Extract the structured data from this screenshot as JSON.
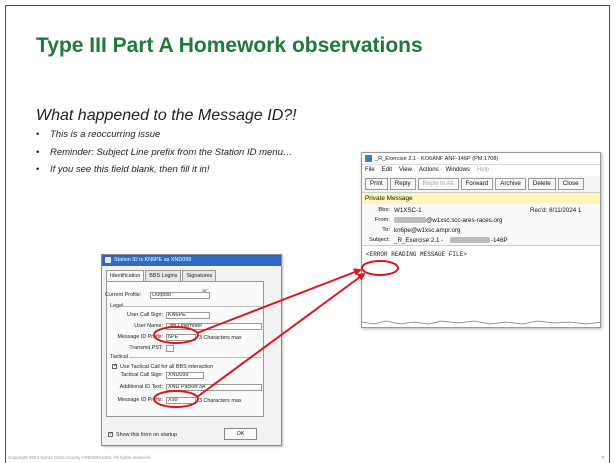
{
  "slide": {
    "title": "Type III Part A Homework observations",
    "subhead": "What happened to the Message ID?!",
    "bullets": [
      "This is a reoccurring issue",
      "Reminder:  Subject Line prefix from the Station ID menu…",
      "If you see this field blank, then fill it in!"
    ],
    "footer": "Copyright 2024 Santa Clara County ARES/RACES.  All rights reserved.",
    "page_number": "8"
  },
  "station_dialog": {
    "title": "Station ID is KN6PE as XND099",
    "tabs": [
      "Identification",
      "BBS Logins",
      "Signatures"
    ],
    "current_profile_label": "Current Profile:",
    "current_profile_value": "Outpost",
    "legal_label": "Legal",
    "user_call_sign_label": "User Call Sign:",
    "user_call_sign_value": "KN6PE",
    "user_name_label": "User Name:",
    "user_name_value": "Jim Oberhofer",
    "message_id_prefix_label": "Message ID Prefix:",
    "message_id_prefix_value": "6PE",
    "characters_max_1": "3 Characters max",
    "transmit_pst_label": "Transmit PST:",
    "tactical_label": "Tactical",
    "use_tactical_label": "Use Tactical Call for all BBS interaction",
    "tactical_call_sign_label": "Tactical Call Sign:",
    "tactical_call_sign_value": "XND099",
    "additional_id_label": "Additional ID Text:",
    "additional_id_value": "XND Packet 3A",
    "message_id_prefix2_label": "Message ID Prefix:",
    "message_id_prefix2_value": "X99",
    "characters_max_2": "3 Characters max",
    "show_on_startup_label": "Show this form on startup",
    "ok_label": "OK"
  },
  "message_window": {
    "title": "_R_Exercise 2.1 - KO6ANF ANF-146P (PM:1708)",
    "menu": [
      "File",
      "Edit",
      "View",
      "Actions",
      "Windows",
      "Help"
    ],
    "toolbar": [
      "Print",
      "Reply",
      "Reply to All",
      "Forward",
      "Archive",
      "Delete",
      "Close"
    ],
    "private_label": "Private Message",
    "bbs_label": "Bbs:",
    "bbs_value": "W1XSC-1",
    "recd_value": "Rec'd: 8/11/2024 1",
    "from_label": "From:",
    "from_value": "@w1xsc.scc-ares-races.org",
    "to_label": "To:",
    "to_value": "kn6pe@w1xsc.ampr.org",
    "subject_label": "Subject:",
    "subject_prefix": "_R_Exercise 2.1 -",
    "subject_suffix": "-146P",
    "body": "<ERROR READING MESSAGE FILE>"
  },
  "colors": {
    "title_green": "#1f7a3a",
    "frame_blue": "#2e4f8c",
    "annotation_red": "#e0141e",
    "private_yellow": "#fdf6b7"
  }
}
